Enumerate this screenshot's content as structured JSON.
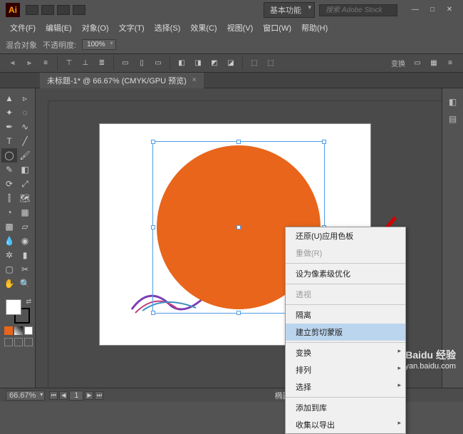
{
  "app": {
    "logo": "Ai"
  },
  "workspace": {
    "label": "基本功能",
    "search_placeholder": "搜索 Adobe Stock"
  },
  "menu": [
    "文件(F)",
    "编辑(E)",
    "对象(O)",
    "文字(T)",
    "选择(S)",
    "效果(C)",
    "视图(V)",
    "窗口(W)",
    "帮助(H)"
  ],
  "control": {
    "label1": "混合对象",
    "label2": "不透明度:",
    "opacity": "100%"
  },
  "doc_tab": "未标题-1* @ 66.67% (CMYK/GPU 预览)",
  "options": {
    "transform": "变换"
  },
  "context_menu": {
    "undo": "还原(U)应用色板",
    "redo": "重做(R)",
    "pixel": "设为像素级优化",
    "perspective": "透视",
    "isolate": "隔离",
    "clipmask": "建立剪切蒙版",
    "transform": "变换",
    "arrange": "排列",
    "select": "选择",
    "addlib": "添加到库",
    "export": "收集以导出"
  },
  "status": {
    "zoom": "66.67%",
    "page": "1",
    "center_label": "椭圆"
  },
  "watermark": {
    "brand": "Baidu 经验",
    "url": "jingyan.baidu.com"
  },
  "colors": {
    "orange": "#e8651b"
  }
}
